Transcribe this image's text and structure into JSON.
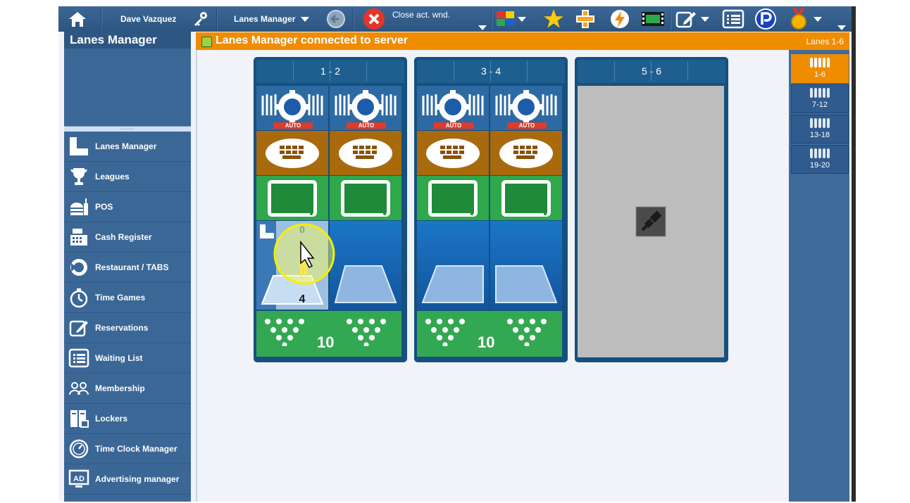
{
  "topbar": {
    "user_name": "Dave Vazquez",
    "module_select": "Lanes Manager",
    "close_label": "Close act. wnd."
  },
  "sidebar": {
    "title": "Lanes Manager",
    "items": [
      {
        "label": "Lanes Manager",
        "icon": "lanes-manager-icon"
      },
      {
        "label": "Leagues",
        "icon": "trophy-icon"
      },
      {
        "label": "POS",
        "icon": "burger-drink-icon"
      },
      {
        "label": "Cash Register",
        "icon": "cash-register-icon"
      },
      {
        "label": "Restaurant / TABS",
        "icon": "restaurant-icon"
      },
      {
        "label": "Time Games",
        "icon": "stopwatch-icon"
      },
      {
        "label": "Reservations",
        "icon": "reservation-pencil-icon"
      },
      {
        "label": "Waiting List",
        "icon": "list-icon"
      },
      {
        "label": "Membership",
        "icon": "members-icon"
      },
      {
        "label": "Lockers",
        "icon": "lockers-icon"
      },
      {
        "label": "Time Clock Manager",
        "icon": "time-clock-icon"
      },
      {
        "label": "Advertising manager",
        "icon": "ad-icon"
      }
    ]
  },
  "status": {
    "message": "Lanes Manager connected to server",
    "range": "Lanes 1-6",
    "status_color": "#f08c00"
  },
  "pairs": [
    {
      "label": "1 - 2",
      "online": true
    },
    {
      "label": "3 - 4",
      "online": true
    },
    {
      "label": "5 - 6",
      "online": false
    }
  ],
  "lane1": {
    "score_top": "0",
    "score_bottom": "4"
  },
  "pin_counts": [
    "10",
    "10"
  ],
  "auto_tag": "AUTO",
  "lane_groups": [
    {
      "label": "1-6",
      "active": true
    },
    {
      "label": "7-12",
      "active": false
    },
    {
      "label": "13-18",
      "active": false
    },
    {
      "label": "19-20",
      "active": false
    }
  ]
}
